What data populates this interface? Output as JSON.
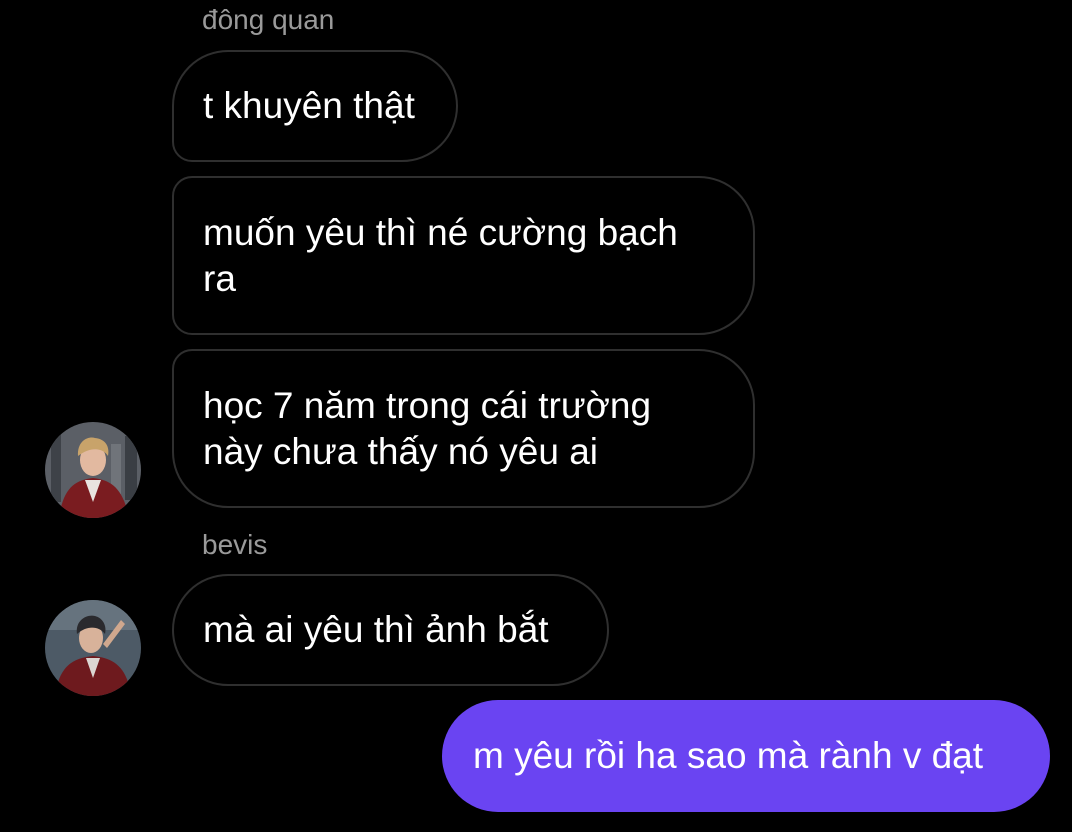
{
  "conversation": {
    "groups": [
      {
        "sender": "đông quan",
        "messages": [
          "t khuyên thật",
          "muốn yêu thì né cường bạch ra",
          "học 7 năm trong cái trường này chưa thấy nó yêu ai"
        ]
      },
      {
        "sender": "bevis",
        "messages": [
          "mà ai yêu thì ảnh bắt"
        ]
      }
    ],
    "outgoing": [
      "m yêu rồi ha sao mà rành v đạt"
    ]
  },
  "colors": {
    "background": "#000000",
    "bubble_border": "#2f2f2f",
    "outgoing_bubble": "#6a44f2",
    "sender_name": "#9a9a9a"
  }
}
